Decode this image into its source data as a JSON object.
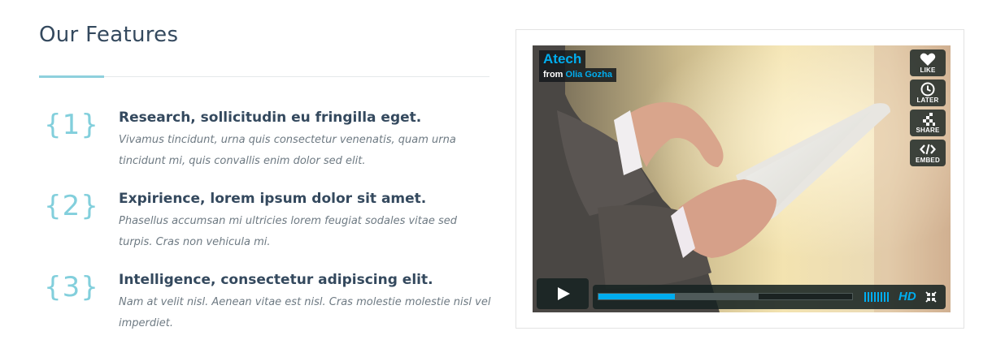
{
  "section": {
    "title": "Our Features"
  },
  "features": [
    {
      "number": "{1}",
      "title": "Research, sollicitudin eu fringilla eget.",
      "description": "Vivamus tincidunt, urna quis consectetur venenatis, quam urna tincidunt mi, quis convallis enim dolor sed elit."
    },
    {
      "number": "{2}",
      "title": "Expirience, lorem ipsum dolor sit amet.",
      "description": "Phasellus accumsan mi ultricies lorem feugiat sodales vitae sed turpis. Cras non vehicula mi."
    },
    {
      "number": "{3}",
      "title": "Intelligence, consectetur adipiscing elit.",
      "description": "Nam at velit nisl. Aenean vitae est nisl. Cras molestie molestie nisl vel imperdiet."
    }
  ],
  "video": {
    "title": "Atech",
    "byline_prefix": "from",
    "author": "Olia Gozha",
    "side_buttons": [
      {
        "label": "LIKE",
        "icon": "heart-icon"
      },
      {
        "label": "LATER",
        "icon": "clock-icon"
      },
      {
        "label": "SHARE",
        "icon": "share-icon"
      },
      {
        "label": "EMBED",
        "icon": "embed-icon"
      }
    ],
    "play_icon": "play-icon",
    "progress_played": 0.3,
    "progress_loaded": 0.63,
    "hd_label": "HD",
    "fullscreen_icon": "fullscreen-icon",
    "colors": {
      "accent": "#00adef",
      "controls_bg": "#172322"
    }
  },
  "colors": {
    "heading": "#34495e",
    "number_accent": "#82cfdc",
    "description": "#6e7a83"
  }
}
